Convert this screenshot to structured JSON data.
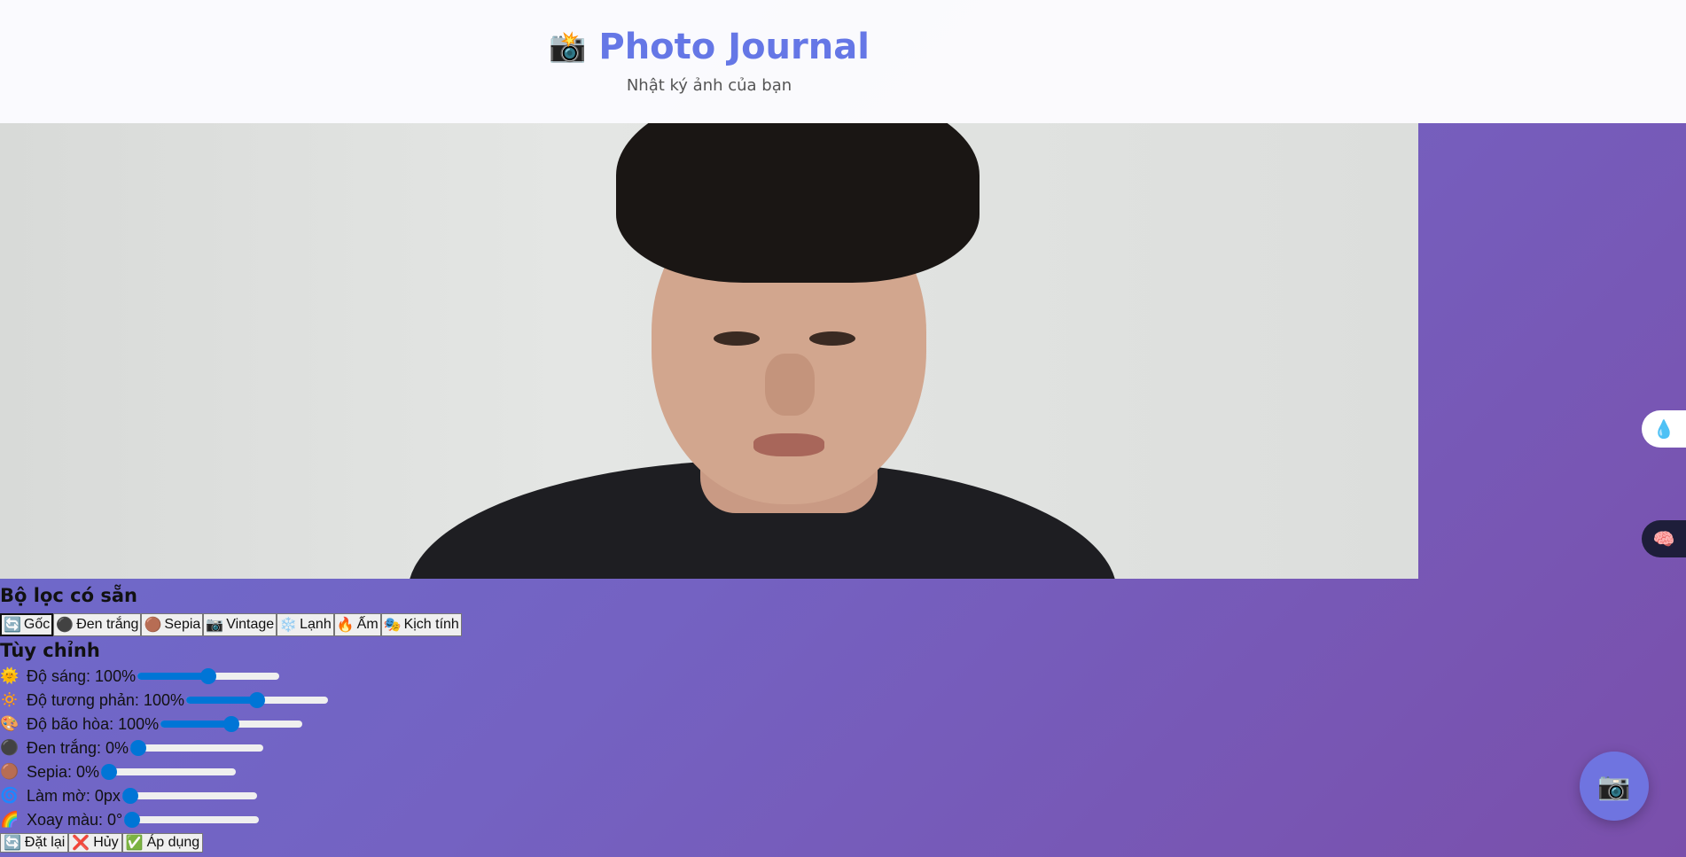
{
  "header": {
    "icon": "camera-icon",
    "title": "Photo Journal",
    "subtitle": "Nhật ký ảnh của bạn"
  },
  "presets": {
    "heading": "Bộ lọc có sẵn",
    "items": [
      {
        "icon": "🔄",
        "label": "Gốc",
        "active": true
      },
      {
        "icon": "⚫",
        "label": "Đen trắng"
      },
      {
        "icon": "🟤",
        "label": "Sepia"
      },
      {
        "icon": "📷",
        "label": "Vintage"
      },
      {
        "icon": "❄️",
        "label": "Lạnh"
      },
      {
        "icon": "🔥",
        "label": "Ấm"
      },
      {
        "icon": "🎭",
        "label": "Kịch tính"
      }
    ]
  },
  "custom": {
    "heading": "Tùy chỉnh",
    "sliders": [
      {
        "icon": "🌞",
        "label": "Độ sáng: 100%",
        "value": 0.5
      },
      {
        "icon": "🔅",
        "label": "Độ tương phản: 100%",
        "value": 0.5
      },
      {
        "icon": "🎨",
        "label": "Độ bão hòa: 100%",
        "value": 0.5
      },
      {
        "icon": "⚫",
        "label": "Đen trắng: 0%",
        "value": 0
      },
      {
        "icon": "🟤",
        "label": "Sepia: 0%",
        "value": 0
      },
      {
        "icon": "🌀",
        "label": "Làm mờ: 0px",
        "value": 0
      },
      {
        "icon": "🌈",
        "label": "Xoay màu: 0°",
        "value": 0
      }
    ]
  },
  "actions": {
    "reset": {
      "icon": "🔄",
      "label": "Đặt lại"
    },
    "cancel": {
      "icon": "❌",
      "label": "Hủy"
    },
    "apply": {
      "icon": "✅",
      "label": "Áp dụng"
    }
  },
  "side_buttons": {
    "drop_icon": "💧",
    "brain_icon": "🧠"
  },
  "fab_icon": "📷",
  "colors": {
    "accent": "#6577e6",
    "slider": "#0075d6"
  }
}
